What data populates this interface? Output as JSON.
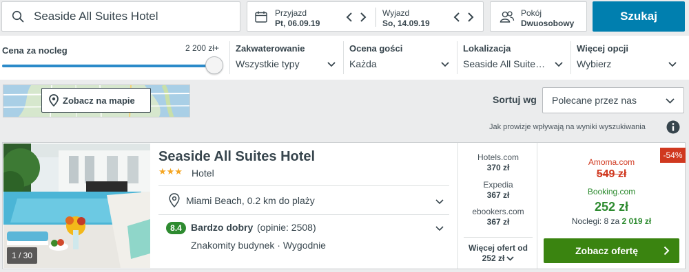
{
  "search": {
    "query": "Seaside All Suites Hotel"
  },
  "dates": {
    "checkin_label": "Przyjazd",
    "checkin_value": "Pt, 06.09.19",
    "checkout_label": "Wyjazd",
    "checkout_value": "So, 14.09.19"
  },
  "guests": {
    "label": "Pokój",
    "value": "Dwuosobowy"
  },
  "search_button": "Szukaj",
  "filters": {
    "price": {
      "label": "Cena za nocleg",
      "max_label": "2 200 zł+",
      "level": 1.0
    },
    "items": [
      {
        "label": "Zakwaterowanie",
        "value": "Wszystkie typy"
      },
      {
        "label": "Ocena gości",
        "value": "Każda"
      },
      {
        "label": "Lokalizacja",
        "value": "Seaside All Suite…"
      },
      {
        "label": "Więcej opcji",
        "value": "Wybierz"
      }
    ]
  },
  "map": {
    "button_label": "Zobacz na mapie"
  },
  "sort": {
    "label": "Sortuj wg",
    "value": "Polecane przez nas"
  },
  "commission_note": "Jak prowizje wpływają na wyniki wyszukiwania",
  "result": {
    "photo_counter": "1 / 30",
    "name": "Seaside All Suites Hotel",
    "stars": 3,
    "stars_text": "★★★",
    "type": "Hotel",
    "location": "Miami Beach, 0.2 km do plaży",
    "rating_score": "8.4",
    "rating_word": "Bardzo dobry",
    "rating_count": "(opinie: 2508)",
    "features": "Znakomity budynek · Wygodnie",
    "deals": [
      {
        "provider": "Hotels.com",
        "price": "370 zł"
      },
      {
        "provider": "Expedia",
        "price": "367 zł"
      },
      {
        "provider": "ebookers.com",
        "price": "367 zł"
      }
    ],
    "more_offers_line1": "Więcej ofert od",
    "more_offers_line2": "252 zł",
    "discount": "-54%",
    "compare_provider": "Amoma.com",
    "compare_price": "549 zł",
    "best_provider": "Booking.com",
    "best_price": "252 zł",
    "nights_label": "Noclegi: 8 za",
    "nights_total": "2 019 zł",
    "cta": "Zobacz ofertę"
  },
  "colors": {
    "primary": "#007faf",
    "green": "#3a8410",
    "rating_green": "#2e8b30",
    "discount_red": "#d0381f",
    "star": "#f5a623"
  }
}
